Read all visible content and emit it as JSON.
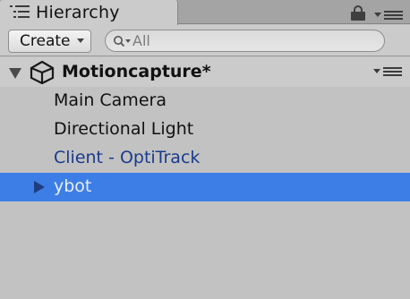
{
  "window": {
    "tab_title": "Hierarchy",
    "tab_icon": "list-hierarchy-icon",
    "lock_icon": "lock-icon",
    "menu_icon": "tab-menu-icon"
  },
  "toolbar": {
    "create_label": "Create",
    "search_placeholder": "All",
    "search_value": ""
  },
  "scene": {
    "name": "Motioncapture*",
    "expanded": true,
    "icon": "unity-logo-icon"
  },
  "items": [
    {
      "label": "Main Camera",
      "color": "#111111",
      "selected": false,
      "has_children": false
    },
    {
      "label": "Directional Light",
      "color": "#111111",
      "selected": false,
      "has_children": false
    },
    {
      "label": "Client - OptiTrack",
      "color": "#1a3a8c",
      "selected": false,
      "has_children": false,
      "prefab": true
    },
    {
      "label": "ybot",
      "color": "#e6eefb",
      "selected": true,
      "has_children": true,
      "prefab": true
    }
  ],
  "colors": {
    "panel_bg": "#c2c2c2",
    "selection": "#3d7ee6",
    "prefab_text": "#1a3a8c"
  }
}
